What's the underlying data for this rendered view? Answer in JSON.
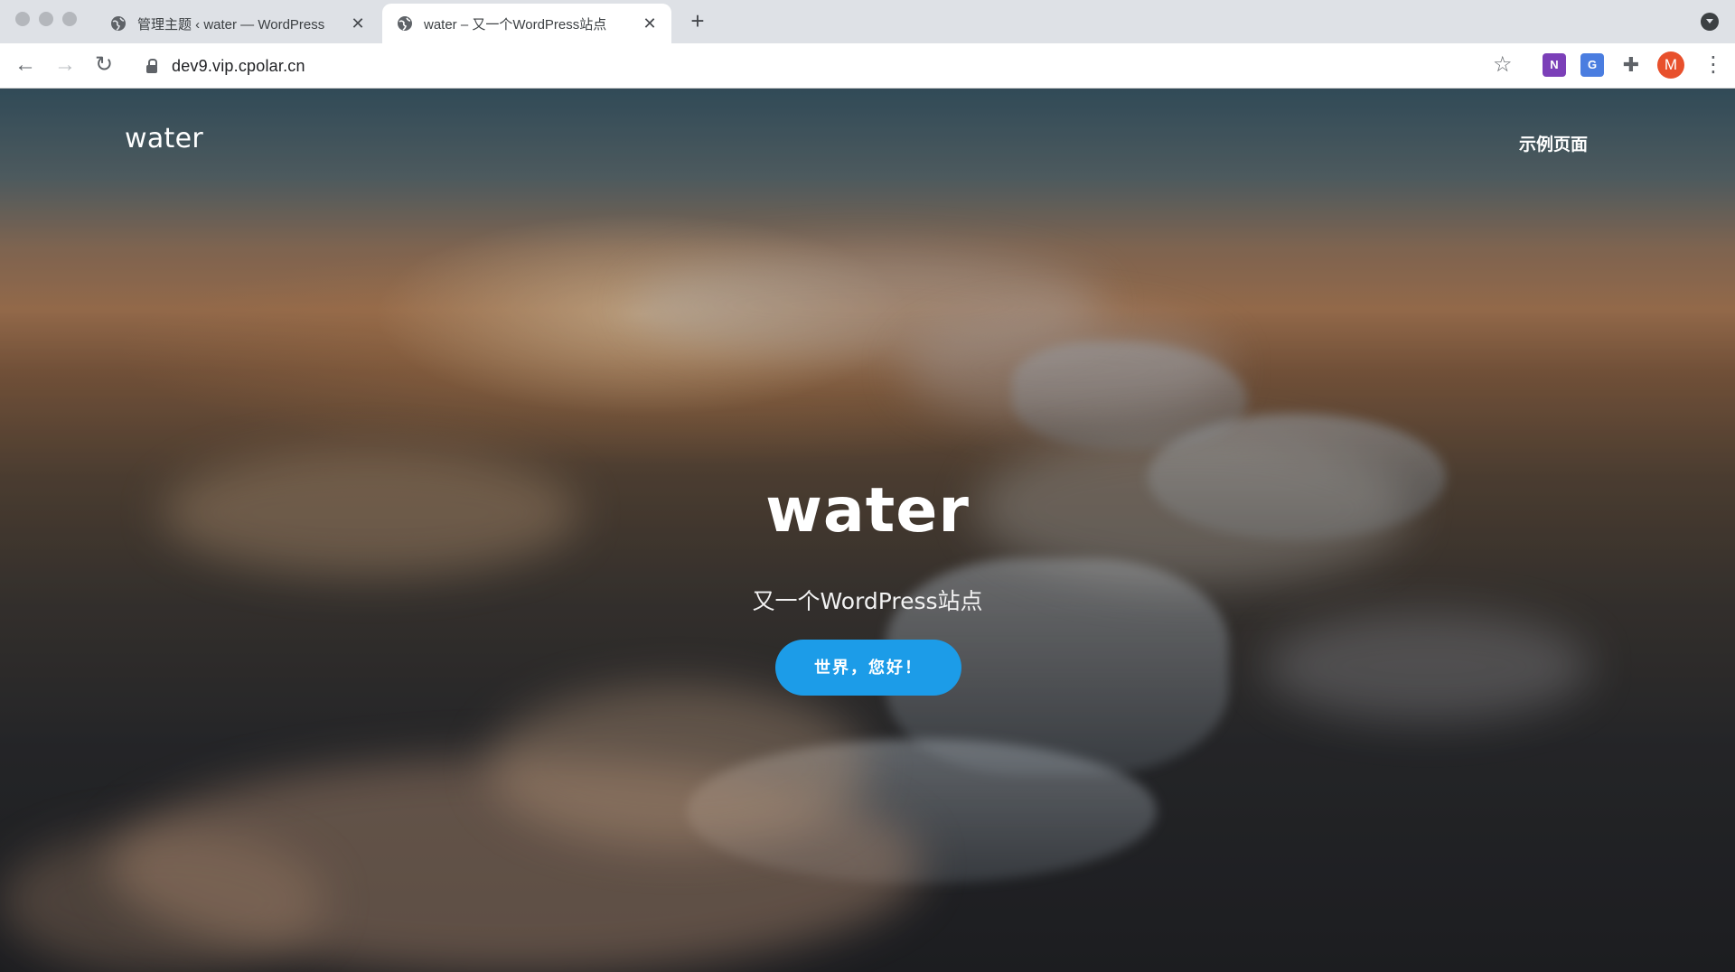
{
  "browser": {
    "tabs": [
      {
        "title": "管理主题 ‹ water — WordPress",
        "active": false
      },
      {
        "title": "water – 又一个WordPress站点",
        "active": true
      }
    ],
    "new_tab_label": "+",
    "close_label": "✕",
    "address_bar": {
      "url": "dev9.vip.cpolar.cn",
      "secure": true
    },
    "icons": [
      "back-icon",
      "forward-icon",
      "reload-icon",
      "lock-icon",
      "bookmark-star-icon",
      "onenote-extension-icon",
      "translate-extension-icon",
      "extensions-puzzle-icon",
      "profile-avatar",
      "more-menu-icon"
    ],
    "profile_initial": "M",
    "colors": {
      "tab_strip": "#dee1e6",
      "avatar": "#e8502c"
    }
  },
  "site": {
    "title": "water",
    "nav_items": [
      "示例页面"
    ]
  },
  "hero": {
    "title": "water",
    "tagline": "又一个WordPress站点",
    "button_label": "世界，您好！",
    "colors": {
      "button": "#1c9ce8",
      "text": "#ffffff"
    }
  }
}
